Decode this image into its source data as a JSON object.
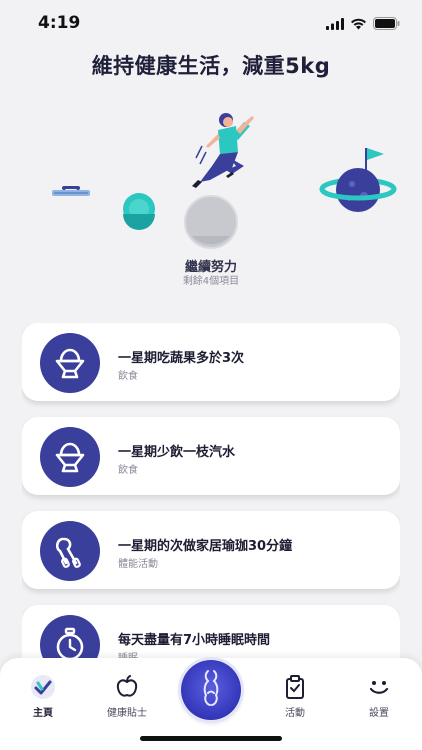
{
  "status_bar": {
    "time": "4:19"
  },
  "header": {
    "title": "維持健康生活，減重5kg"
  },
  "progress": {
    "label": "繼續努力",
    "subtitle": "剩餘4個項目"
  },
  "tasks": [
    {
      "title": "一星期吃蔬果多於3次",
      "category": "飲食",
      "icon": "egg-cup-icon"
    },
    {
      "title": "一星期少飲一枝汽水",
      "category": "飲食",
      "icon": "egg-cup-icon"
    },
    {
      "title": "一星期的次做家居瑜珈30分鐘",
      "category": "體能活動",
      "icon": "hand-grip-icon"
    },
    {
      "title": "每天盡量有7小時睡眠時間",
      "category": "睡眠",
      "icon": "stopwatch-icon"
    }
  ],
  "tab_bar": {
    "items": [
      {
        "label": "主頁",
        "icon": "home-logo-icon",
        "active": true
      },
      {
        "label": "健康貼士",
        "icon": "apple-icon",
        "active": false
      },
      {
        "label": "活動",
        "icon": "clipboard-icon",
        "active": false
      },
      {
        "label": "設置",
        "icon": "smile-icon",
        "active": false
      }
    ],
    "center_icon": "body-figure-icon"
  },
  "colors": {
    "accent": "#3a3f9c",
    "background": "#f2f2f4",
    "teal": "#2cc7c0"
  }
}
